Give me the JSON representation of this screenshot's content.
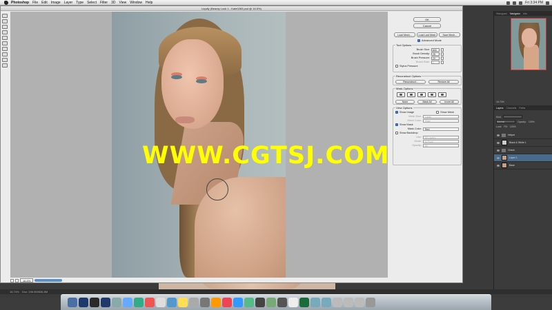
{
  "menubar": {
    "app": "Photoshop",
    "items": [
      "File",
      "Edit",
      "Image",
      "Layer",
      "Type",
      "Select",
      "Filter",
      "3D",
      "View",
      "Window",
      "Help"
    ],
    "clock": "Fri 3:34 PM"
  },
  "liquify": {
    "title": "Liquify (Beauty Look 1 - Kate0283.psd @ 16.5%)",
    "zoom": "16.5%",
    "ok": "OK",
    "cancel": "Cancel",
    "load_mesh": "Load Mesh...",
    "load_last_mesh": "Load Last Mesh",
    "save_mesh": "Save Mesh...",
    "advanced_mode": "Advanced Mode",
    "tool_options": {
      "title": "Tool Options",
      "brush_size_label": "Brush Size:",
      "brush_size": "600",
      "brush_density_label": "Brush Density:",
      "brush_density": "25",
      "brush_pressure_label": "Brush Pressure:",
      "brush_pressure": "29",
      "brush_rate_label": "Brush Rate:",
      "brush_rate": "0",
      "stylus_pressure": "Stylus Pressure"
    },
    "reconstruct_options": {
      "title": "Reconstruct Options",
      "reconstruct": "Reconstruct...",
      "restore_all": "Restore All"
    },
    "mask_options": {
      "title": "Mask Options",
      "none": "None",
      "mask_all": "Mask All",
      "invert_all": "Invert All"
    },
    "view_options": {
      "title": "View Options",
      "show_image": "Show Image",
      "show_mesh": "Show Mesh",
      "mesh_size_label": "Mesh Size:",
      "mesh_size": "Large",
      "mesh_color_label": "Mesh Color:",
      "mesh_color": "Gray",
      "show_mask": "Show Mask",
      "mask_color_label": "Mask Color:",
      "mask_color": "Red",
      "show_backdrop": "Show Backdrop",
      "use_label": "Use:",
      "use": "All Layers",
      "mode_label": "Mode:",
      "mode": "In Front",
      "opacity_label": "Opacity:",
      "opacity": "50"
    }
  },
  "watermark": "WWW.CGTSJ.COM",
  "panels": {
    "nav_tabs": [
      "Histogram",
      "Navigator",
      "Info"
    ],
    "nav_zoom": "16.74%",
    "layer_tabs": [
      "Layers",
      "Channels",
      "Paths"
    ],
    "kind_label": "Kind",
    "blend_mode": "Normal",
    "opacity_label": "Opacity:",
    "opacity": "100%",
    "lock_label": "Lock:",
    "fill_label": "Fill:",
    "fill": "100%",
    "layers": [
      {
        "name": "Helper",
        "type": "folder",
        "selected": false
      },
      {
        "name": "Black & White 1",
        "type": "adjustment",
        "selected": false
      },
      {
        "name": "Check",
        "type": "folder",
        "selected": false
      },
      {
        "name": "Layer 1",
        "type": "photo",
        "selected": true
      },
      {
        "name": "Base",
        "type": "photo",
        "selected": false
      }
    ]
  },
  "status": {
    "zoom": "16.74%",
    "doc": "Doc: 206.9M/636.8M"
  },
  "colors": {
    "watermark": "#ffff00",
    "selected_layer": "#4a6a8a",
    "zoom_bar": "#5a8fd0"
  }
}
